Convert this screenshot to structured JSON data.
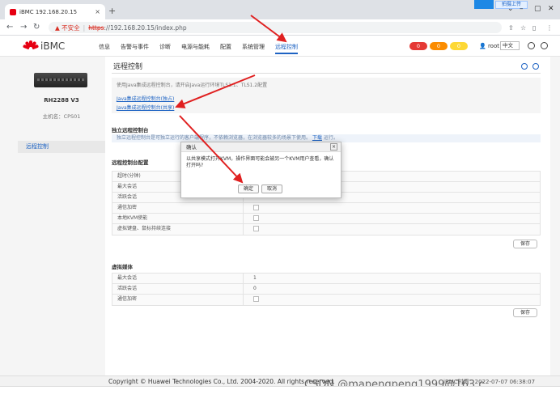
{
  "browser": {
    "tab_title": "iBMC 192.168.20.15",
    "tab_close": "×",
    "new_tab": "+",
    "warning": "▲ 不安全",
    "protocol": "https",
    "url_rest": "://192.168.20.15/index.php",
    "ext_label": "拍摄上传"
  },
  "header": {
    "brand": "iBMC",
    "nav": [
      "信息",
      "告警与事件",
      "诊断",
      "电源与能耗",
      "配置",
      "系统管理",
      "远程控制"
    ],
    "alarms": [
      {
        "count": "0",
        "color": "#e53935"
      },
      {
        "count": "0",
        "color": "#fb8c00"
      },
      {
        "count": "0",
        "color": "#fdd835"
      }
    ],
    "user": "root",
    "language": "中文"
  },
  "sidebar": {
    "model": "RH2288 V3",
    "hostname": "主机名：CPS01",
    "item": "远程控制"
  },
  "main": {
    "title": "远程控制",
    "intro": "使用Java集成远程控制台，请开启Java运行环境TLS1.1、TLS1.2配置",
    "link_exclusive": "Java集成远程控制台(独占)",
    "link_shared": "Java集成远程控制台(共享)",
    "standalone_title": "独立远程控制台",
    "standalone_notice_a": "独立远程控制台是可独立运行的客户端程序，不依赖浏览器，在浏览器较多的场景下使用。",
    "standalone_download": "下载",
    "standalone_notice_b": "运行。",
    "config_title": "远程控制台配置",
    "config_rows": [
      "超时(分钟)",
      "最大会话",
      "活跃会话",
      "通信加密",
      "本地KVM使能",
      "虚拟键盘、鼠标持续连接"
    ],
    "media_title": "虚拟媒体",
    "media_rows": [
      {
        "label": "最大会话",
        "value": "1"
      },
      {
        "label": "活跃会话",
        "value": "0"
      },
      {
        "label": "通信加密",
        "value": ""
      }
    ],
    "save": "保存"
  },
  "modal": {
    "title": "确认",
    "close": "×",
    "message": "以共享模式打开KVM，操作界面可能会被另一个KVM用户查看，确认打开吗?",
    "ok": "确定",
    "cancel": "取消"
  },
  "footer": {
    "copyright": "Copyright © Huawei Technologies Co., Ltd. 2004-2020. All rights reserved.",
    "time": "iBMC时间：2022-07-07 06:38:07"
  },
  "watermark": "CSDN @mapengpeng1999@163.c"
}
